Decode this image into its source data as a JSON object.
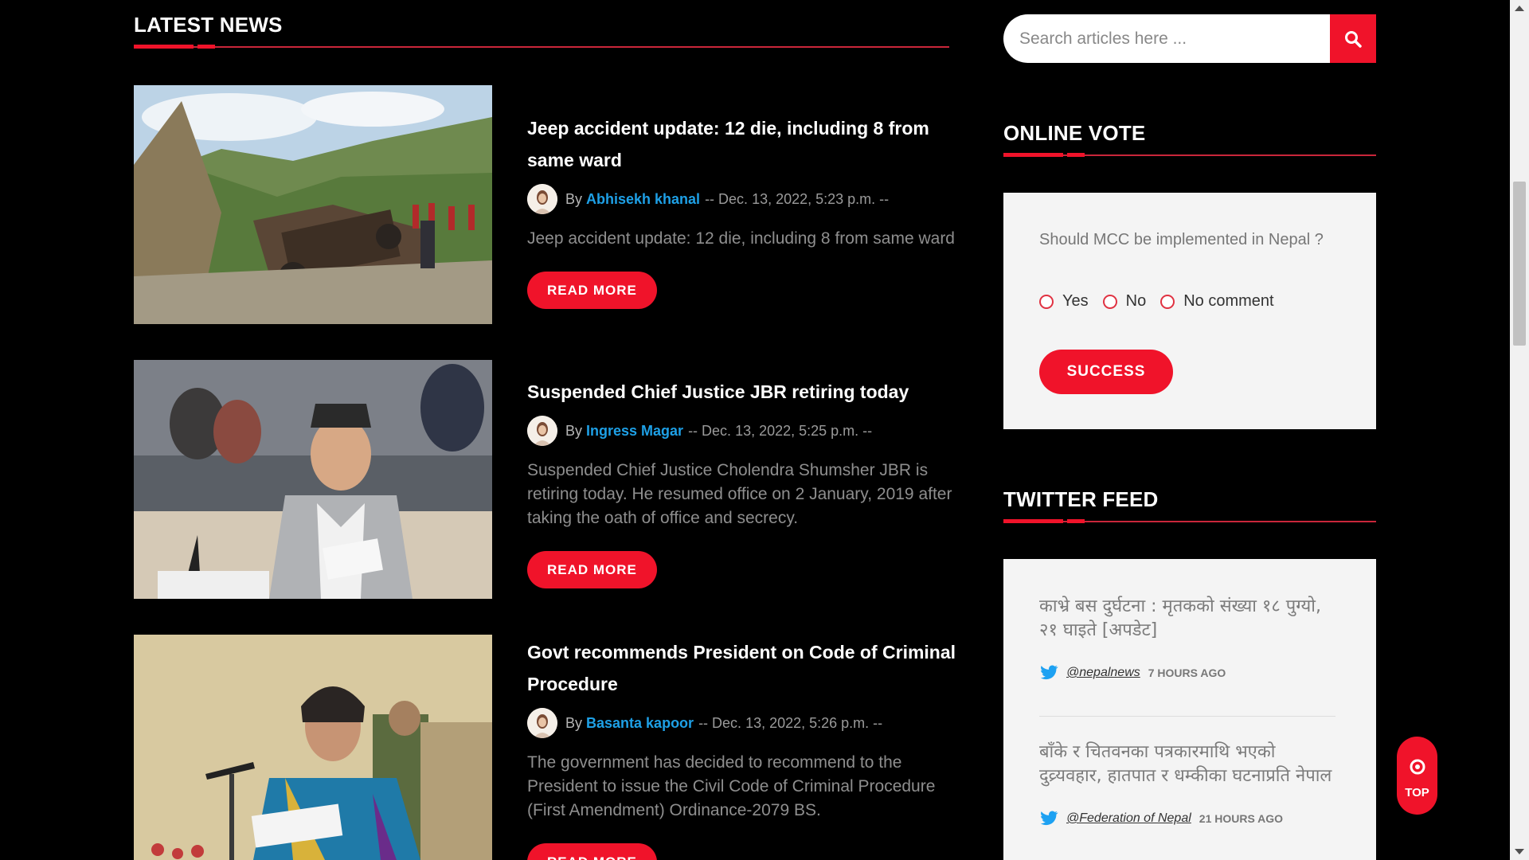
{
  "latest_news": {
    "title": "LATEST NEWS",
    "articles": [
      {
        "title": "Jeep accident update: 12 die, including 8 from same ward",
        "by": "By",
        "author": "Abhisekh khanal",
        "date": "-- Dec. 13, 2022, 5:23 p.m. --",
        "excerpt": "Jeep accident update: 12 die, including 8 from same ward",
        "read_more": "READ MORE"
      },
      {
        "title": "Suspended Chief Justice JBR retiring today",
        "by": "By",
        "author": "Ingress Magar",
        "date": "-- Dec. 13, 2022, 5:25 p.m. --",
        "excerpt": "Suspended Chief Justice Cholendra Shumsher JBR is retiring today. He resumed office on 2 January, 2019 after taking the oath of office and secrecy.",
        "read_more": "READ MORE"
      },
      {
        "title": "Govt recommends President on Code of Criminal Procedure",
        "by": "By",
        "author": "Basanta kapoor",
        "date": "-- Dec. 13, 2022, 5:26 p.m. --",
        "excerpt": "The government has decided to recommend to the President to issue the Civil Code of Criminal Procedure (First Amendment) Ordinance-2079 BS.",
        "read_more": "READ MORE"
      }
    ]
  },
  "search": {
    "placeholder": "Search articles here ...",
    "icon": "search-icon"
  },
  "online_vote": {
    "title": "ONLINE VOTE",
    "question": "Should MCC be implemented in Nepal ?",
    "options": [
      "Yes",
      "No",
      "No comment"
    ],
    "submit": "SUCCESS"
  },
  "twitter_feed": {
    "title": "TWITTER FEED",
    "tweets": [
      {
        "text": "काभ्रे बस दुर्घटना : मृतकको संख्या १८ पुग्यो, २१ घाइते [अपडेट]",
        "handle": "@nepalnews",
        "time": "7 HOURS AGO"
      },
      {
        "text": "बाँके र चितवनका पत्रकारमाथि भएको दुव्र्यवहार, हातपात र धम्कीका घटनाप्रति नेपाल",
        "handle": "@Federation of Nepal",
        "time": "21 HOURS AGO"
      }
    ]
  },
  "top_button": {
    "label": "TOP"
  },
  "colors": {
    "accent": "#f0132a",
    "link": "#1ea0e6",
    "background": "#000000",
    "panel": "#f4f4f4"
  }
}
